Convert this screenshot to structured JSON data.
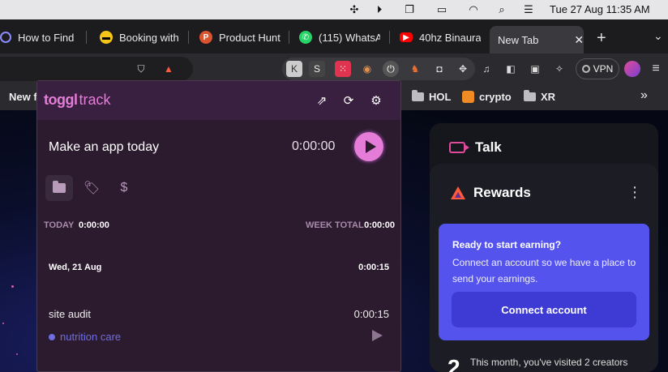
{
  "menubar": {
    "clock": "Tue 27 Aug  11:35 AM"
  },
  "tabs": [
    {
      "label": "How to Find",
      "favicon": "podcast-icon",
      "color": "#8b8bff"
    },
    {
      "label": "Booking with",
      "favicon": "booking-icon",
      "color": "#f5c518"
    },
    {
      "label": "Product Hunt",
      "favicon": "producthunt-icon",
      "color": "#da552f"
    },
    {
      "label": "(115) WhatsA",
      "favicon": "whatsapp-icon",
      "color": "#25d366"
    },
    {
      "label": "40hz Binaura",
      "favicon": "youtube-icon",
      "color": "#ff0000"
    },
    {
      "label": "New Tab",
      "favicon": "",
      "color": "",
      "active": true
    }
  ],
  "toolbar": {
    "vpn_label": "VPN"
  },
  "bookmarks": [
    {
      "label": "New f",
      "type": "folder"
    },
    {
      "label": "HOL",
      "type": "folder"
    },
    {
      "label": "crypto",
      "type": "app"
    },
    {
      "label": "XR",
      "type": "folder"
    }
  ],
  "toggl": {
    "logo_toggl": "toggl",
    "logo_track": "track",
    "description": "Make an app today",
    "timer": "0:00:00",
    "today_label": "TODAY",
    "today_value": "0:00:00",
    "week_label": "WEEK TOTAL",
    "week_value": "0:00:00",
    "day_header": "Wed, 21 Aug",
    "day_total": "0:00:15",
    "entries": [
      {
        "description": "site audit",
        "duration": "0:00:15",
        "project": "nutrition care",
        "project_color": "#6e6ee0"
      }
    ]
  },
  "right_panel": {
    "talk_label": "Talk",
    "rewards_label": "Rewards",
    "earn_title": "Ready to start earning?",
    "earn_text": "Connect an account so we have a place to send your earnings.",
    "connect_button": "Connect account",
    "visited_number": "2",
    "visited_text": "This month, you've visited 2 creators"
  },
  "colors": {
    "toggl_accent": "#e57cd8",
    "rewards_box": "#5553ee"
  }
}
